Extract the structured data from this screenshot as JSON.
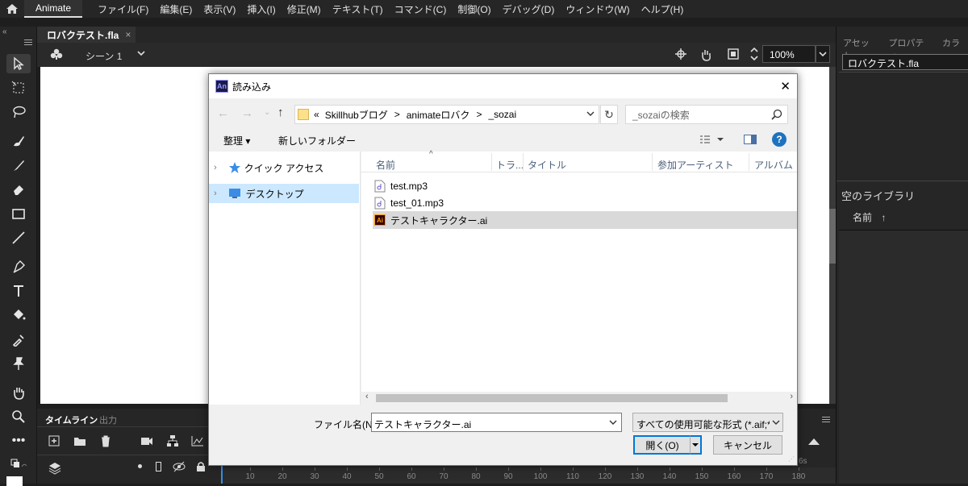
{
  "app": {
    "tab_label": "Animate",
    "menu": [
      "ファイル(F)",
      "編集(E)",
      "表示(V)",
      "挿入(I)",
      "修正(M)",
      "テキスト(T)",
      "コマンド(C)",
      "制御(O)",
      "デバッグ(D)",
      "ウィンドウ(W)",
      "ヘルプ(H)"
    ]
  },
  "document": {
    "tab_title": "ロバクテスト.fla",
    "tab_close": "×",
    "scene_label": "シーン 1",
    "zoom": "100%"
  },
  "right_panel": {
    "tabs": [
      "アセット",
      "プロパティ",
      "カラー"
    ],
    "doc_name": "ロバクテスト.fla",
    "library_title": "空のライブラリ",
    "name_column": "名前",
    "sort_arrow": "↑"
  },
  "timeline": {
    "tabs": [
      "タイムライン",
      "出力"
    ],
    "ruler_ticks": [
      "10",
      "20",
      "30",
      "40",
      "50",
      "60",
      "70",
      "80",
      "90",
      "100",
      "110",
      "120",
      "130",
      "140",
      "150",
      "160",
      "170",
      "180"
    ],
    "time_marker": "6s"
  },
  "dialog": {
    "app_badge": "An",
    "title": "読み込み",
    "close": "✕",
    "breadcrumb": [
      "«",
      "Skillhubブログ",
      ">",
      "animateロバク",
      ">",
      "_sozai"
    ],
    "search_placeholder": "_sozaiの検索",
    "organize": "整理 ▾",
    "new_folder": "新しいフォルダー",
    "help": "?",
    "nav_items": [
      {
        "label": "クイック アクセス",
        "icon": "star-icon"
      },
      {
        "label": "デスクトップ",
        "icon": "desktop-icon",
        "selected": true
      }
    ],
    "columns": [
      "名前",
      "トラ...",
      "タイトル",
      "参加アーティスト",
      "アルバム"
    ],
    "files": [
      {
        "name": "test.mp3",
        "icon": "audio-file-icon"
      },
      {
        "name": "test_01.mp3",
        "icon": "audio-file-icon"
      },
      {
        "name": "テストキャラクター.ai",
        "icon": "illustrator-file-icon",
        "selected": true
      }
    ],
    "filename_label": "ファイル名(N):",
    "filename_value": "テストキャラクター.ai",
    "filetype_value": "すべての使用可能な形式 (*.aif;*.a",
    "open_button": "開く(O)",
    "cancel_button": "キャンセル"
  },
  "colors": {
    "dialog_bg": "#f0f0f0",
    "selection": "#cce8ff",
    "file_selected": "#d9d9d9",
    "help_blue": "#1e73be",
    "an_badge": "#1a1a4a"
  }
}
